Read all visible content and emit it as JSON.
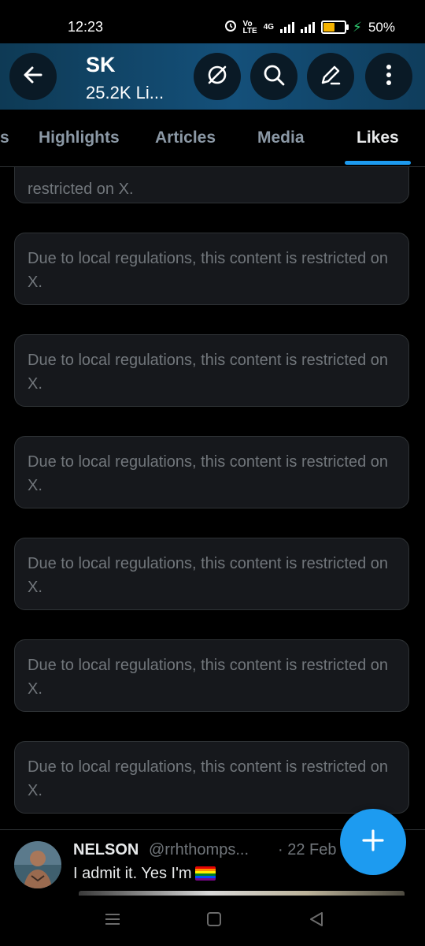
{
  "status_bar": {
    "time": "12:23",
    "network": "4G",
    "battery": "50%",
    "battery_level": 0.5
  },
  "header": {
    "title": "SK",
    "subtitle": "25.2K Li...",
    "icons": [
      "back-arrow-icon",
      "grok-icon",
      "search-icon",
      "compose-icon",
      "more-vertical-icon"
    ]
  },
  "tabs": {
    "items": [
      "s",
      "Highlights",
      "Articles",
      "Media",
      "Likes"
    ],
    "active": "Likes"
  },
  "restricted_cards": [
    {
      "text": "restricted on X."
    },
    {
      "text": "Due to local regulations, this content is restricted on X."
    },
    {
      "text": "Due to local regulations, this content is restricted on X."
    },
    {
      "text": "Due to local regulations, this content is restricted on X."
    },
    {
      "text": "Due to local regulations, this content is restricted on X."
    },
    {
      "text": "Due to local regulations, this content is restricted on X."
    },
    {
      "text": "Due to local regulations, this content is restricted on X."
    }
  ],
  "tweet": {
    "name": "NELSON",
    "handle": "@rrhthomps...",
    "date": "· 22 Feb",
    "text": "I admit it. Yes I'm"
  },
  "fab": {
    "icon": "plus-icon"
  },
  "colors": {
    "accent": "#1d9bf0",
    "card_bg": "#16181c",
    "card_border": "#2f3336",
    "muted_text": "#71767b"
  }
}
